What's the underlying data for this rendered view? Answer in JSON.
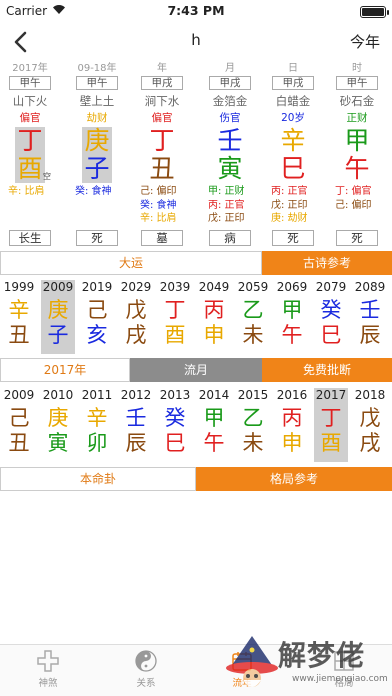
{
  "status": {
    "carrier": "Carrier",
    "time": "7:43 PM"
  },
  "nav": {
    "title": "h",
    "right": "今年"
  },
  "colors": {
    "fire": "#e02020",
    "wood": "#1a9a1a",
    "water": "#1a2adf",
    "earth": "#8a4a10",
    "metal": "#e8a800",
    "orange": "#f08418"
  },
  "pillars": [
    {
      "name": "2017年",
      "ganzhi": "甲午",
      "nayin": "山下火",
      "shishen": "偏官",
      "shishen_color": "#e02020",
      "stem": "丁",
      "stem_color": "#e02020",
      "branch": "酉",
      "branch_color": "#e8a800",
      "kong": "空",
      "cang": [
        {
          "t": "辛: 比肩",
          "c": "#e8a800"
        }
      ],
      "stage": "长生",
      "highlight": true
    },
    {
      "name": "09-18年",
      "ganzhi": "甲午",
      "nayin": "壁上土",
      "shishen": "劫财",
      "shishen_color": "#e8a800",
      "stem": "庚",
      "stem_color": "#e8a800",
      "branch": "子",
      "branch_color": "#1a2adf",
      "kong": "",
      "cang": [
        {
          "t": "癸: 食神",
          "c": "#1a2adf"
        }
      ],
      "stage": "死",
      "highlight": true
    },
    {
      "name": "年",
      "ganzhi": "甲戌",
      "nayin": "涧下水",
      "shishen": "偏官",
      "shishen_color": "#e02020",
      "stem": "丁",
      "stem_color": "#e02020",
      "branch": "丑",
      "branch_color": "#8a4a10",
      "kong": "",
      "cang": [
        {
          "t": "己: 偏印",
          "c": "#8a4a10"
        },
        {
          "t": "癸: 食神",
          "c": "#1a2adf"
        },
        {
          "t": "辛: 比肩",
          "c": "#e8a800"
        }
      ],
      "stage": "墓",
      "highlight": false
    },
    {
      "name": "月",
      "ganzhi": "甲戌",
      "nayin": "金箔金",
      "shishen": "伤官",
      "shishen_color": "#1a2adf",
      "stem": "壬",
      "stem_color": "#1a2adf",
      "branch": "寅",
      "branch_color": "#1a9a1a",
      "kong": "",
      "cang": [
        {
          "t": "甲: 正财",
          "c": "#1a9a1a"
        },
        {
          "t": "丙: 正官",
          "c": "#e02020"
        },
        {
          "t": "戊: 正印",
          "c": "#8a4a10"
        }
      ],
      "stage": "病",
      "highlight": false
    },
    {
      "name": "日",
      "ganzhi": "甲戌",
      "nayin": "白蜡金",
      "shishen": "20岁",
      "shishen_color": "#1a2adf",
      "stem": "辛",
      "stem_color": "#e8a800",
      "branch": "巳",
      "branch_color": "#e02020",
      "kong": "",
      "cang": [
        {
          "t": "丙: 正官",
          "c": "#e02020"
        },
        {
          "t": "戊: 正印",
          "c": "#8a4a10"
        },
        {
          "t": "庚: 劫财",
          "c": "#e8a800"
        }
      ],
      "stage": "死",
      "highlight": false
    },
    {
      "name": "时",
      "ganzhi": "甲午",
      "nayin": "砂石金",
      "shishen": "正财",
      "shishen_color": "#1a9a1a",
      "stem": "甲",
      "stem_color": "#1a9a1a",
      "branch": "午",
      "branch_color": "#e02020",
      "kong": "",
      "cang": [
        {
          "t": "丁: 偏官",
          "c": "#e02020"
        },
        {
          "t": "己: 偏印",
          "c": "#8a4a10"
        }
      ],
      "stage": "死",
      "highlight": false
    }
  ],
  "bar1": {
    "left": "大运",
    "right": "古诗参考"
  },
  "dayun": [
    {
      "y": "1999",
      "s": "辛",
      "sc": "#e8a800",
      "b": "丑",
      "bc": "#8a4a10",
      "hl": false
    },
    {
      "y": "2009",
      "s": "庚",
      "sc": "#e8a800",
      "b": "子",
      "bc": "#1a2adf",
      "hl": true
    },
    {
      "y": "2019",
      "s": "己",
      "sc": "#8a4a10",
      "b": "亥",
      "bc": "#1a2adf",
      "hl": false
    },
    {
      "y": "2029",
      "s": "戊",
      "sc": "#8a4a10",
      "b": "戌",
      "bc": "#8a4a10",
      "hl": false
    },
    {
      "y": "2039",
      "s": "丁",
      "sc": "#e02020",
      "b": "酉",
      "bc": "#e8a800",
      "hl": false
    },
    {
      "y": "2049",
      "s": "丙",
      "sc": "#e02020",
      "b": "申",
      "bc": "#e8a800",
      "hl": false
    },
    {
      "y": "2059",
      "s": "乙",
      "sc": "#1a9a1a",
      "b": "未",
      "bc": "#8a4a10",
      "hl": false
    },
    {
      "y": "2069",
      "s": "甲",
      "sc": "#1a9a1a",
      "b": "午",
      "bc": "#e02020",
      "hl": false
    },
    {
      "y": "2079",
      "s": "癸",
      "sc": "#1a2adf",
      "b": "巳",
      "bc": "#e02020",
      "hl": false
    },
    {
      "y": "2089",
      "s": "壬",
      "sc": "#1a2adf",
      "b": "辰",
      "bc": "#8a4a10",
      "hl": false
    }
  ],
  "bar2": {
    "left": "2017年",
    "mid": "流月",
    "right": "免费批断"
  },
  "liunian": [
    {
      "y": "2009",
      "s": "己",
      "sc": "#8a4a10",
      "b": "丑",
      "bc": "#8a4a10",
      "hl": false
    },
    {
      "y": "2010",
      "s": "庚",
      "sc": "#e8a800",
      "b": "寅",
      "bc": "#1a9a1a",
      "hl": false
    },
    {
      "y": "2011",
      "s": "辛",
      "sc": "#e8a800",
      "b": "卯",
      "bc": "#1a9a1a",
      "hl": false
    },
    {
      "y": "2012",
      "s": "壬",
      "sc": "#1a2adf",
      "b": "辰",
      "bc": "#8a4a10",
      "hl": false
    },
    {
      "y": "2013",
      "s": "癸",
      "sc": "#1a2adf",
      "b": "巳",
      "bc": "#e02020",
      "hl": false
    },
    {
      "y": "2014",
      "s": "甲",
      "sc": "#1a9a1a",
      "b": "午",
      "bc": "#e02020",
      "hl": false
    },
    {
      "y": "2015",
      "s": "乙",
      "sc": "#1a9a1a",
      "b": "未",
      "bc": "#8a4a10",
      "hl": false
    },
    {
      "y": "2016",
      "s": "丙",
      "sc": "#e02020",
      "b": "申",
      "bc": "#e8a800",
      "hl": false
    },
    {
      "y": "2017",
      "s": "丁",
      "sc": "#e02020",
      "b": "酉",
      "bc": "#e8a800",
      "hl": true
    },
    {
      "y": "2018",
      "s": "戊",
      "sc": "#8a4a10",
      "b": "戌",
      "bc": "#8a4a10",
      "hl": false
    }
  ],
  "bar3": {
    "left": "本命卦",
    "right": "格局参考"
  },
  "tabs": [
    {
      "label": "神煞",
      "icon": "cross-icon"
    },
    {
      "label": "关系",
      "icon": "yinyang-icon"
    },
    {
      "label": "流年",
      "icon": "calendar-icon"
    },
    {
      "label": "格局",
      "icon": "grid-icon"
    }
  ],
  "watermark": {
    "text": "解梦佬",
    "url": "www.jiemengiao.com"
  }
}
